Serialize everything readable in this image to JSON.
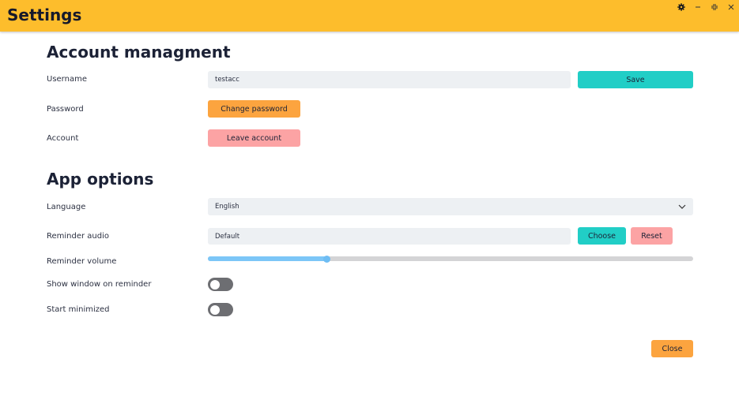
{
  "window": {
    "title": "Settings",
    "controls": [
      "gear-icon",
      "minimize-icon",
      "restore-icon",
      "close-icon"
    ]
  },
  "account": {
    "heading": "Account managment",
    "username_label": "Username",
    "username_value": "testacc",
    "save_label": "Save",
    "password_label": "Password",
    "change_password_label": "Change password",
    "account_label": "Account",
    "leave_account_label": "Leave account"
  },
  "app_options": {
    "heading": "App options",
    "language_label": "Language",
    "language_value": "English",
    "reminder_audio_label": "Reminder audio",
    "reminder_audio_value": "Default",
    "choose_label": "Choose",
    "reset_label": "Reset",
    "reminder_volume_label": "Reminder volume",
    "reminder_volume_fraction": 0.245,
    "show_window_label": "Show window on reminder",
    "show_window_on": false,
    "start_minimized_label": "Start minimized",
    "start_minimized_on": false
  },
  "footer": {
    "close_label": "Close"
  },
  "colors": {
    "titlebar": "#fdbd2c",
    "accent_teal": "#21cec6",
    "accent_orange": "#fca43f",
    "accent_pink": "#fca3a4",
    "slider_fill": "#7cc6f7",
    "toggle_off": "#6d6e72"
  }
}
